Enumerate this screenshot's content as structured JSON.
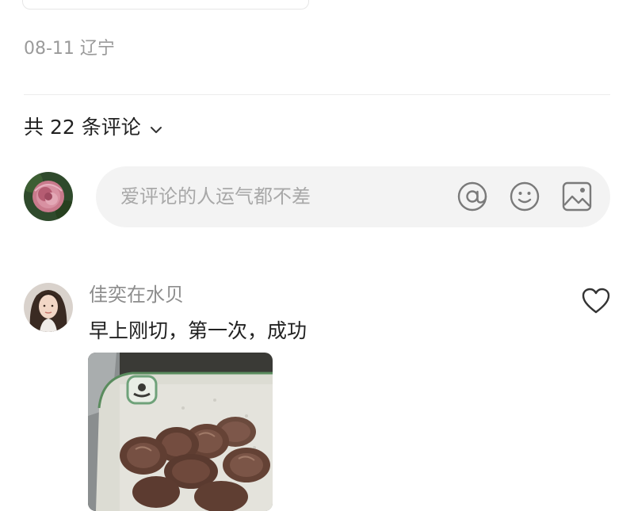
{
  "post": {
    "meta_text": "08-11 辽宁"
  },
  "comments_section": {
    "count_label": "共 22 条评论",
    "input": {
      "placeholder": "爱评论的人运气都不差"
    }
  },
  "comments": [
    {
      "username": "佳奕在水贝",
      "text": "早上刚切，第一次，成功"
    }
  ],
  "icons": {
    "sort_toggle": "chevron-down-icon",
    "mention": "at-icon",
    "emoji": "smiley-icon",
    "image": "image-icon",
    "like": "heart-icon"
  }
}
